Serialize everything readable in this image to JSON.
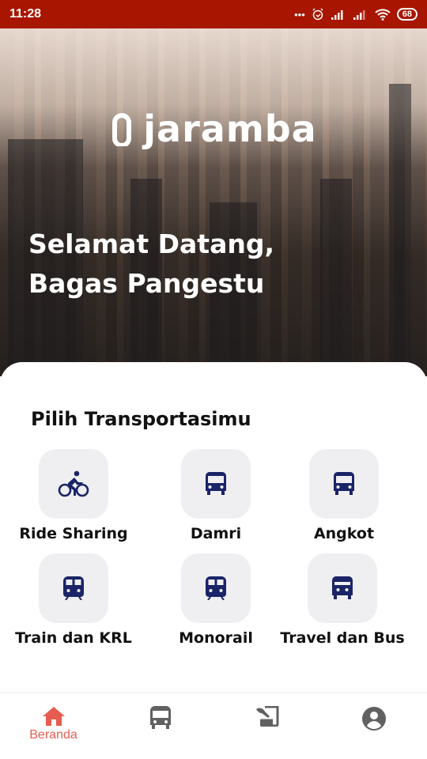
{
  "status_bar": {
    "time": "11:28",
    "battery": "68",
    "icons": [
      "more-dots-icon",
      "alarm-icon",
      "signal-icon",
      "signal-icon",
      "wifi-icon",
      "battery-icon"
    ]
  },
  "hero": {
    "logo_text": "jaramba",
    "welcome_line1": "Selamat Datang,",
    "welcome_line2": "Bagas Pangestu"
  },
  "main": {
    "section_title": "Pilih Transportasimu",
    "transports": [
      {
        "label": "Ride Sharing",
        "icon": "bike-icon"
      },
      {
        "label": "Damri",
        "icon": "bus-icon"
      },
      {
        "label": "Angkot",
        "icon": "bus-icon"
      },
      {
        "label": "Train dan KRL",
        "icon": "train-icon"
      },
      {
        "label": "Monorail",
        "icon": "train-icon"
      },
      {
        "label": "Travel dan Bus",
        "icon": "bus-alt-icon"
      }
    ]
  },
  "bottom_nav": {
    "items": [
      {
        "label": "Beranda",
        "icon": "home-icon",
        "active": true
      },
      {
        "label": "",
        "icon": "bus-icon",
        "active": false
      },
      {
        "label": "",
        "icon": "ticket-icon",
        "active": false
      },
      {
        "label": "",
        "icon": "account-icon",
        "active": false
      }
    ]
  },
  "colors": {
    "status_bar": "#a81500",
    "accent": "#e65c4f",
    "icon_navy": "#1a2466",
    "nav_inactive": "#616161",
    "tile_bg": "#efeff1"
  }
}
